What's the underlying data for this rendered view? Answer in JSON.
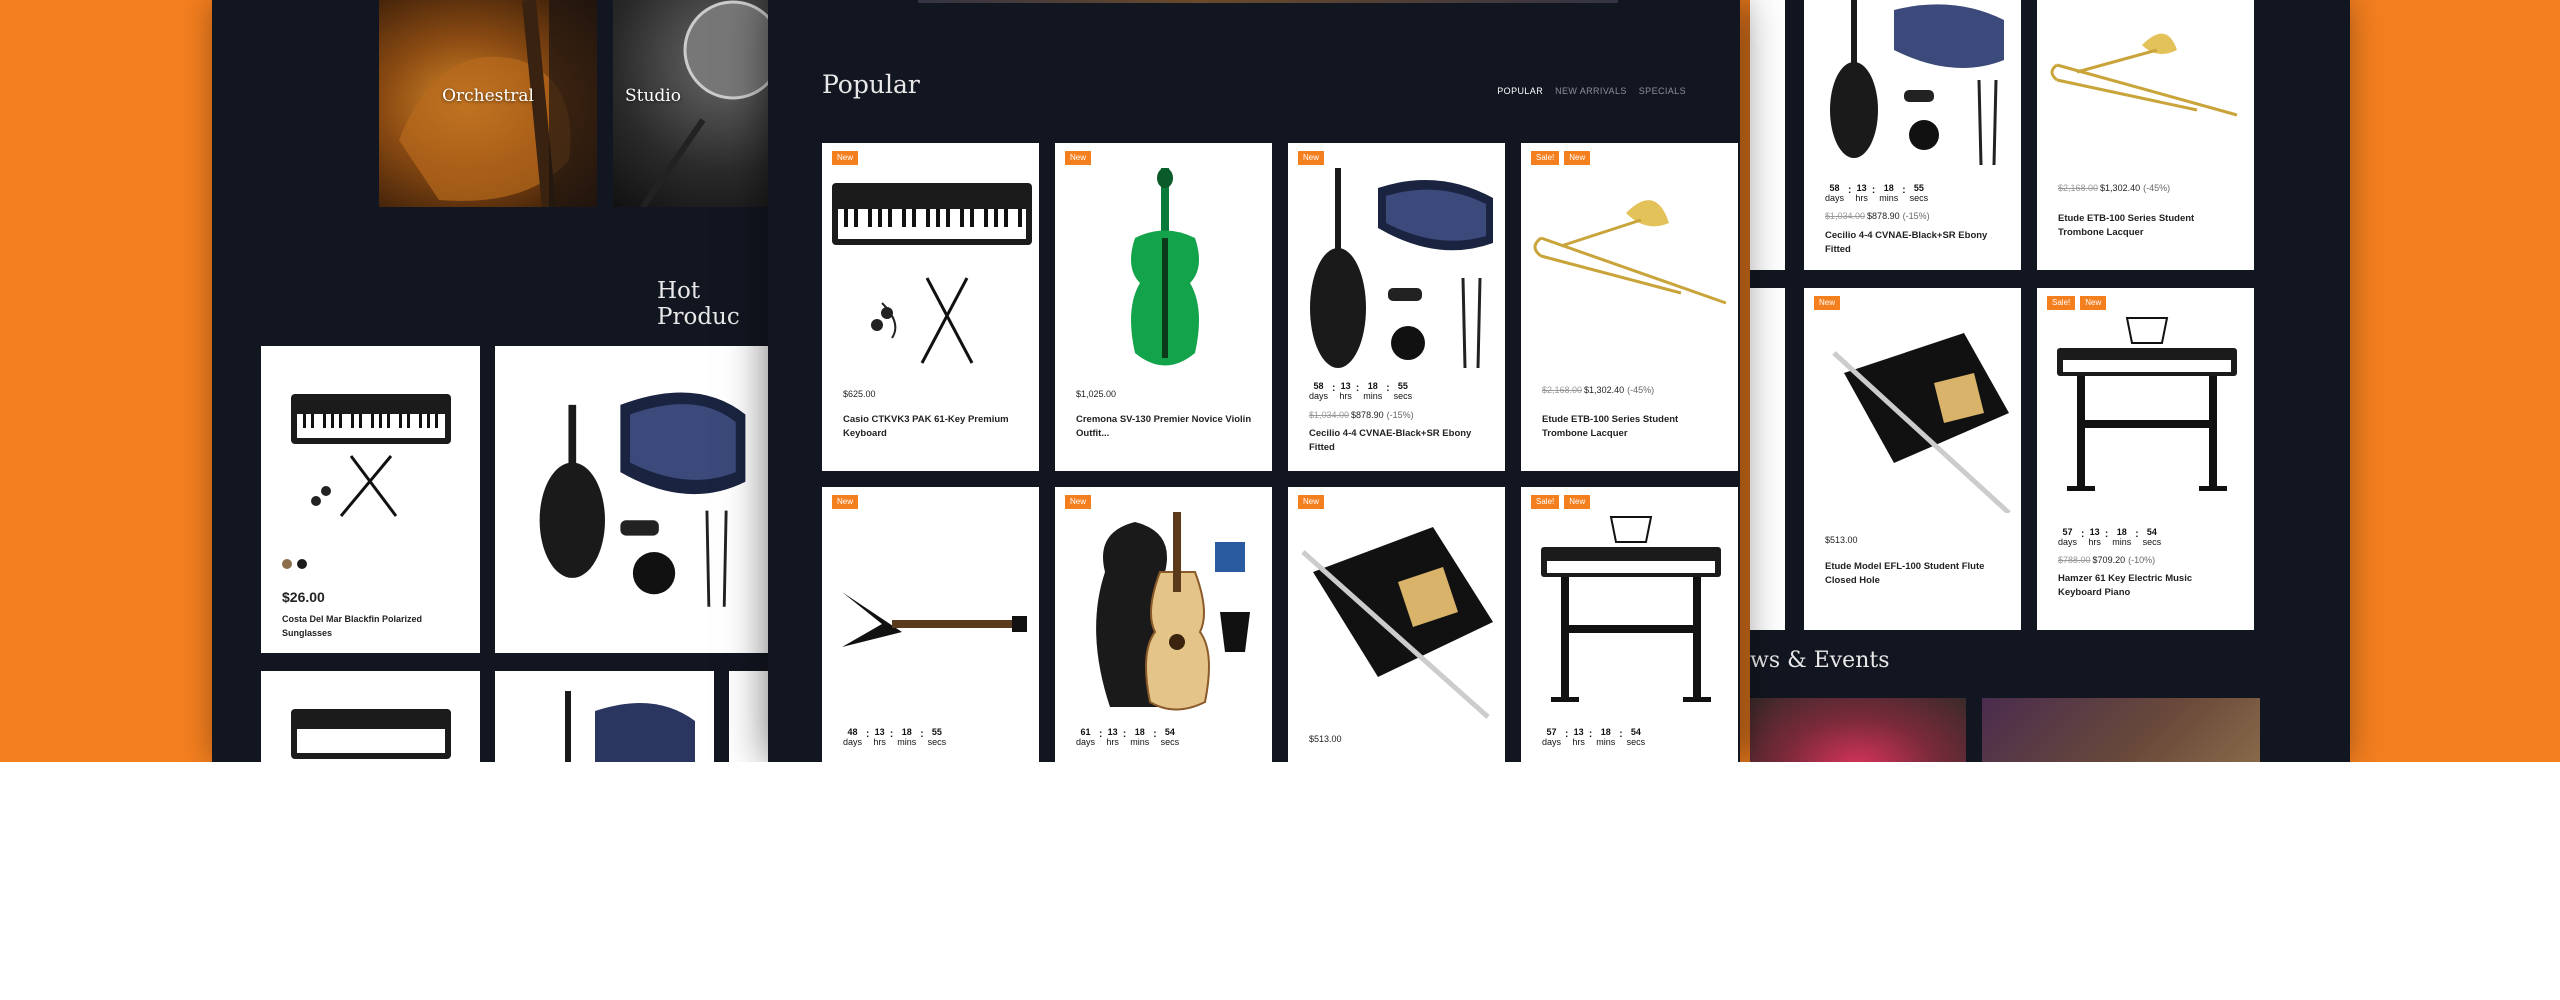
{
  "left_panel": {
    "categories": [
      {
        "label": "Orchestral",
        "icon": "violin-photo"
      },
      {
        "label": "Studio",
        "icon": "microphone-photo"
      }
    ],
    "section_title": "Hot Produc",
    "product": {
      "price": "$26.00",
      "name": "Costa Del Mar Blackfin Polarized Sunglasses",
      "swatches": [
        "#8a6e4b",
        "#1c1c1c"
      ]
    }
  },
  "center_panel": {
    "section_title": "Popular",
    "tabs": [
      {
        "label": "POPULAR",
        "active": true
      },
      {
        "label": "NEW ARRIVALS",
        "active": false
      },
      {
        "label": "SPECIALS",
        "active": false
      }
    ],
    "products": [
      {
        "badges": [
          "New"
        ],
        "price": "$625.00",
        "name": "Casio CTKVK3 PAK 61-Key Premium Keyboard",
        "icon": "keyboard-icon"
      },
      {
        "badges": [
          "New"
        ],
        "price": "$1,025.00",
        "name": "Cremona SV-130 Premier Novice Violin Outfit...",
        "icon": "green-violin-icon"
      },
      {
        "badges": [
          "New"
        ],
        "countdown": [
          "58",
          "13",
          "18",
          "55"
        ],
        "old_price": "$1,034.00",
        "price": "$878.90",
        "discount": "(-15%)",
        "name": "Cecilio 4-4 CVNAE-Black+SR Ebony Fitted",
        "icon": "violin-case-icon"
      },
      {
        "badges": [
          "Sale!",
          "New"
        ],
        "old_price": "$2,168.00",
        "price": "$1,302.40",
        "discount": "(-45%)",
        "name": "Etude ETB-100 Series Student Trombone Lacquer",
        "icon": "trombone-icon"
      },
      {
        "badges": [
          "New"
        ],
        "countdown": [
          "48",
          "13",
          "18",
          "55"
        ],
        "icon": "electric-guitar-icon"
      },
      {
        "badges": [
          "New"
        ],
        "countdown": [
          "61",
          "13",
          "18",
          "54"
        ],
        "icon": "acoustic-guitar-icon"
      },
      {
        "badges": [
          "New"
        ],
        "price": "$513.00",
        "icon": "flute-icon"
      },
      {
        "badges": [
          "Sale!",
          "New"
        ],
        "countdown": [
          "57",
          "13",
          "18",
          "54"
        ],
        "icon": "keyboard-stand-icon"
      }
    ],
    "countdown_labels": [
      "days",
      "hrs",
      "mins",
      "secs"
    ]
  },
  "right_panel": {
    "products": [
      {
        "countdown": [
          "58",
          "13",
          "18",
          "55"
        ],
        "old_price": "$1,034.00",
        "price": "$878.90",
        "discount": "(-15%)",
        "name": "Cecilio 4-4 CVNAE-Black+SR Ebony Fitted"
      },
      {
        "old_price": "$2,168.00",
        "price": "$1,302.40",
        "discount": "(-45%)",
        "name": "Etude ETB-100 Series Student Trombone Lacquer"
      },
      {
        "badges": [
          "New"
        ],
        "price": "$513.00",
        "name": "Etude Model EFL-100 Student Flute Closed Hole"
      },
      {
        "badges": [
          "Sale!",
          "New"
        ],
        "countdown": [
          "57",
          "13",
          "18",
          "54"
        ],
        "old_price": "$788.00",
        "price": "$709.20",
        "discount": "(-10%)",
        "name": "Hamzer 61 Key Electric Music Keyboard Piano"
      }
    ],
    "news_title": "ws & Events"
  },
  "colors": {
    "accent": "#f47f1f",
    "panel": "#121620",
    "card": "#ffffff"
  }
}
